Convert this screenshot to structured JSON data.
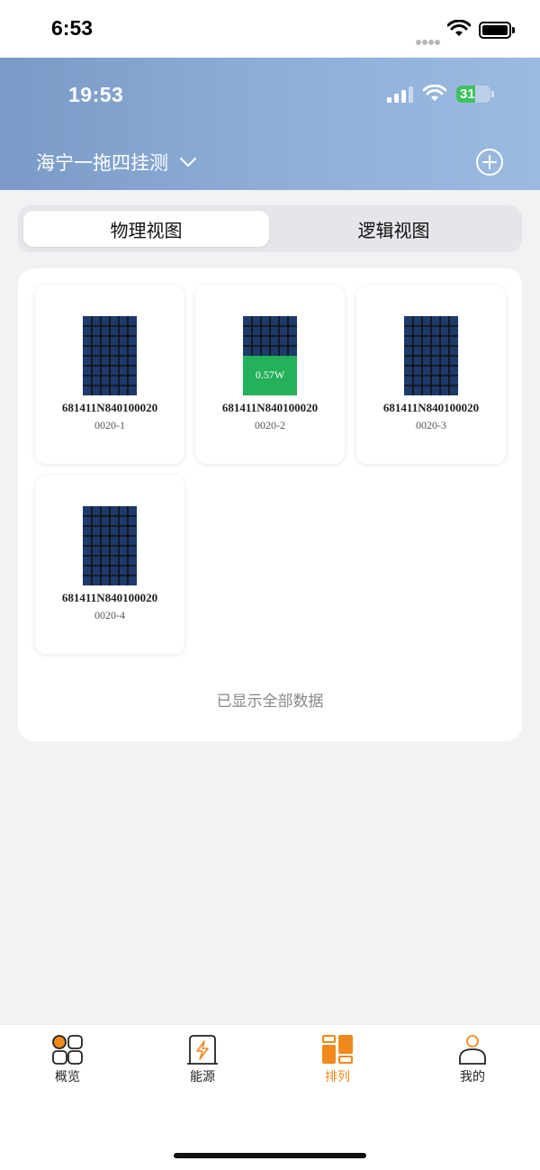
{
  "outer_status": {
    "time": "6:53"
  },
  "app_status": {
    "time": "19:53",
    "battery": "31"
  },
  "header": {
    "site_name": "海宁一拖四挂测"
  },
  "segment": {
    "tabs": [
      "物理视图",
      "逻辑视图"
    ],
    "active_index": 0
  },
  "modules": [
    {
      "serial": "681411N840100020",
      "position": "0020-1",
      "power": ""
    },
    {
      "serial": "681411N840100020",
      "position": "0020-2",
      "power": "0.57W"
    },
    {
      "serial": "681411N840100020",
      "position": "0020-3",
      "power": ""
    },
    {
      "serial": "681411N840100020",
      "position": "0020-4",
      "power": ""
    }
  ],
  "end_note": "已显示全部数据",
  "tabbar": {
    "items": [
      "概览",
      "能源",
      "排列",
      "我的"
    ],
    "active_index": 2
  },
  "colors": {
    "accent": "#f08a1c",
    "panel_cell": "#1e3a6b",
    "power_green": "#25b05a",
    "header": "#8eb0d8"
  }
}
